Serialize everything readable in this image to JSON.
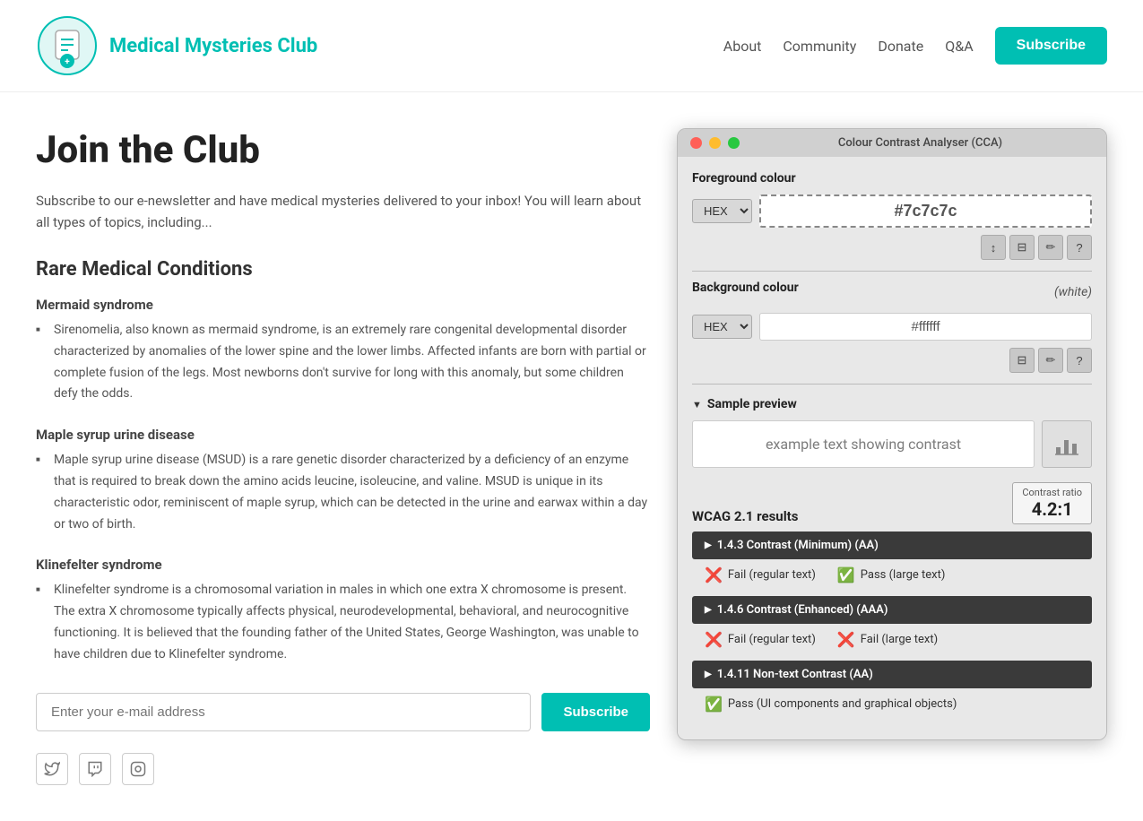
{
  "header": {
    "logo_title": "Medical Mysteries Club",
    "nav": {
      "about": "About",
      "community": "Community",
      "donate": "Donate",
      "qa": "Q&A",
      "subscribe": "Subscribe"
    }
  },
  "content": {
    "page_title": "Join the Club",
    "intro": "Subscribe to our e-newsletter and have medical mysteries delivered to your inbox! You will learn about all types of topics, including...",
    "section_title": "Rare Medical Conditions",
    "conditions": [
      {
        "name": "Mermaid syndrome",
        "desc": "Sirenomelia, also known as mermaid syndrome, is an extremely rare congenital developmental disorder characterized by anomalies of the lower spine and the lower limbs. Affected infants are born with partial or complete fusion of the legs. Most newborns don't survive for long with this anomaly, but some children defy the odds."
      },
      {
        "name": "Maple syrup urine disease",
        "desc": "Maple syrup urine disease (MSUD) is a rare genetic disorder characterized by a deficiency of an enzyme that is required to break down the amino acids leucine, isoleucine, and valine. MSUD is unique in its characteristic odor, reminiscent of maple syrup, which can be detected in the urine and earwax within a day or two of birth."
      },
      {
        "name": "Klinefelter syndrome",
        "desc": "Klinefelter syndrome is a chromosomal variation in males in which one extra X chromosome is present. The extra X chromosome typically affects physical, neurodevelopmental, behavioral, and neurocognitive functioning. It is believed that the founding father of the United States, George Washington, was unable to have children due to Klinefelter syndrome."
      }
    ],
    "email_placeholder": "Enter your e-mail address",
    "subscribe_btn": "Subscribe"
  },
  "cca": {
    "title": "Colour Contrast Analyser (CCA)",
    "foreground_label": "Foreground colour",
    "fg_format": "HEX",
    "fg_value": "#7c7c7c",
    "fg_tools": [
      "↕",
      "⊟",
      "✏",
      "?"
    ],
    "background_label": "Background colour",
    "bg_white_label": "(white)",
    "bg_format": "HEX",
    "bg_value": "#ffffff",
    "bg_tools": [
      "⊟",
      "✏",
      "?"
    ],
    "sample_preview_label": "Sample preview",
    "sample_text": "example text showing contrast",
    "chart_icon": "📊",
    "wcag_label": "WCAG 2.1 results",
    "contrast_ratio_label": "Contrast ratio",
    "contrast_ratio_value": "4.2:1",
    "wcag_items": [
      {
        "id": "1.4.3",
        "label": "1.4.3 Contrast (Minimum) (AA)",
        "results": [
          {
            "pass": false,
            "text": "Fail (regular text)"
          },
          {
            "pass": true,
            "text": "Pass (large text)"
          }
        ]
      },
      {
        "id": "1.4.6",
        "label": "1.4.6 Contrast (Enhanced) (AAA)",
        "results": [
          {
            "pass": false,
            "text": "Fail (regular text)"
          },
          {
            "pass": false,
            "text": "Fail (large text)"
          }
        ]
      },
      {
        "id": "1.4.11",
        "label": "1.4.11 Non-text Contrast (AA)",
        "results": [
          {
            "pass": true,
            "text": "Pass (UI components and graphical objects)"
          }
        ]
      }
    ]
  },
  "social": {
    "icons": [
      "𝕏",
      "📺",
      "📷"
    ]
  }
}
